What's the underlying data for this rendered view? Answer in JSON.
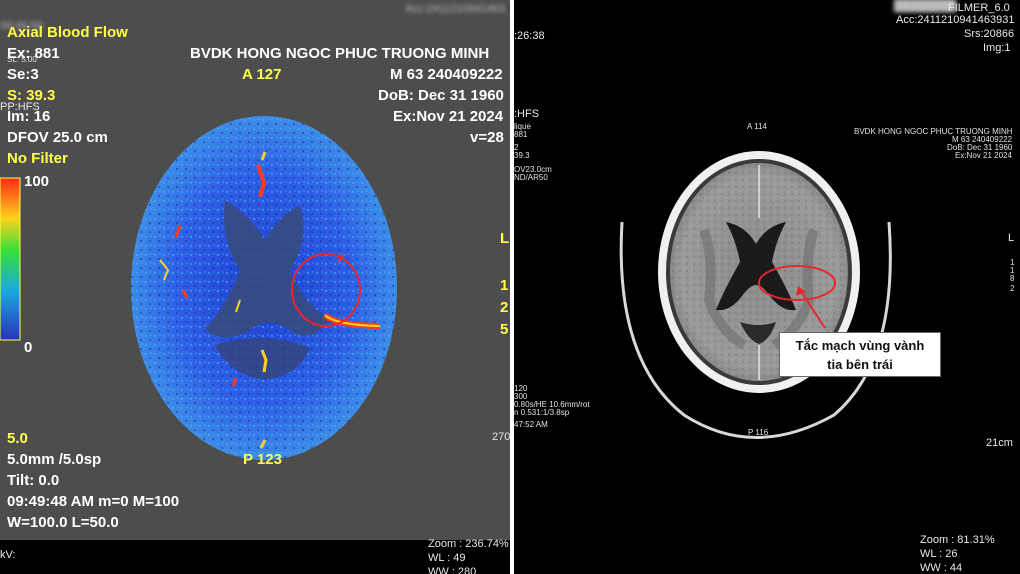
{
  "left_panel": {
    "top_clipped": "09:46:58",
    "top_right_clipped": "Acc:2411210941463",
    "title": "Axial Blood Flow",
    "hospital": "BVDK HONG NGOC PHUC TRUONG MINH",
    "ex": "Ex: 881",
    "se": "Se:3",
    "se_clipped": "SL: 5.00",
    "s": "S: 39.3",
    "pp": "PP:HFS",
    "im": "Im: 16",
    "dfov": "DFOV 25.0 cm",
    "filter": "No Filter",
    "anterior": "A 127",
    "patient": "M 63 240409222",
    "dob": "DoB: Dec 31 1960",
    "exam": "Ex:Nov 21 2024",
    "v": "v=28",
    "scale_max": "100",
    "scale_min": "0",
    "posterior": "P 123",
    "bl_1": "5.0",
    "bl_2": "5.0mm /5.0sp",
    "bl_3": "Tilt: 0.0",
    "bl_4": "09:49:48 AM m=0 M=100",
    "bl_5": "W=100.0 L=50.0",
    "kv": "kV:",
    "zoom": "Zoom : 236.74%",
    "wl": "WL : 49",
    "ww": "WW : 280",
    "right_edge_chars": [
      "L",
      "1",
      "2",
      "5"
    ],
    "right_edge_number": "270"
  },
  "right_panel": {
    "filmer": "FILMER_6.0",
    "acc": "Acc:2411210941463931",
    "srs": "Srs:20866",
    "img": "Img:1",
    "time_clipped": ":26:38",
    "hfs": ":HFS",
    "left_small": [
      "lique",
      "881",
      "2",
      "39.3",
      "",
      "OV23.0cm",
      "ND/AR50"
    ],
    "anterior": "A 114",
    "hospital": "BVDK HONG NGOC PHUC TRUONG MINH",
    "patient": "M 63 240409222",
    "dob": "DoB: Dec 31 1960",
    "exam": "Ex:Nov 21 2024",
    "callout_line1": "Tắc mạch vùng vành",
    "callout_line2": "tia bên trái",
    "posterior": "P 116",
    "left_tech": [
      "120",
      "300",
      "0.80s/HE 10.6mm/rot",
      "n 0.531:1/3.8sp",
      "47:52 AM"
    ],
    "right_edge_chars": [
      "L",
      "1",
      "1",
      "8",
      "2"
    ],
    "scale": "21cm",
    "zoom": "Zoom : 81.31%",
    "wl": "WL : 26",
    "ww": "WW : 44",
    "colors": {
      "annotation_red": "#e8262a",
      "callout_bg": "#ffffff"
    }
  }
}
